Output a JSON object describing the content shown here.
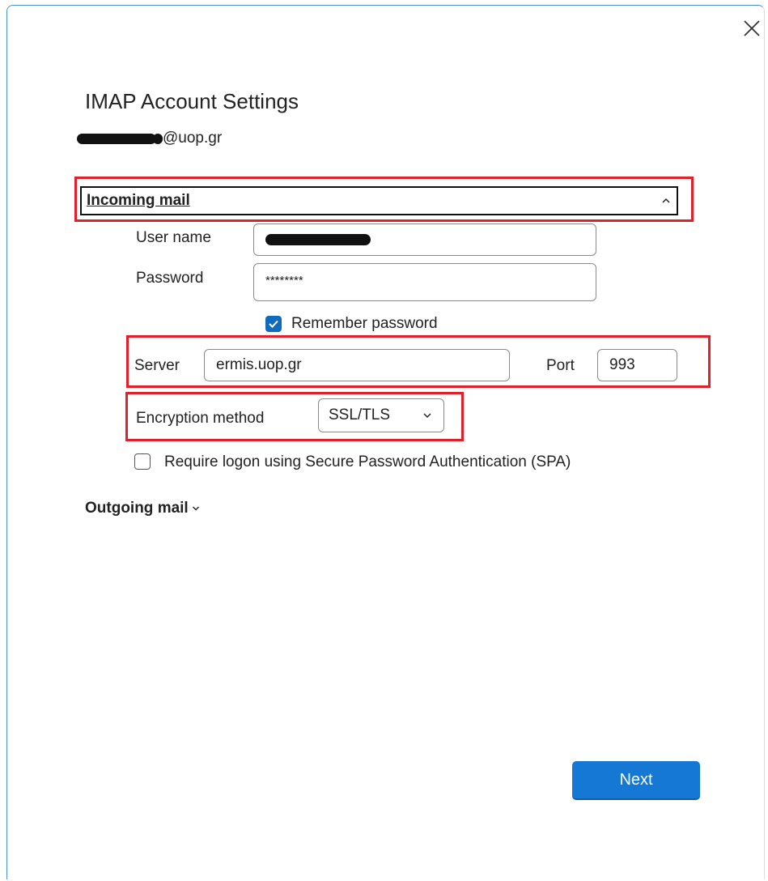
{
  "dialog": {
    "title": "IMAP Account Settings",
    "email_suffix": "@uop.gr",
    "close_icon": "close-icon"
  },
  "incoming": {
    "header_label": "Incoming mail",
    "header_icon": "chevron-up-icon",
    "username_label": "User name",
    "username_value": "",
    "password_label": "Password",
    "password_value": "********",
    "remember_label": "Remember password",
    "remember_checked": true,
    "server_label": "Server",
    "server_value": "ermis.uop.gr",
    "port_label": "Port",
    "port_value": "993",
    "encryption_label": "Encryption method",
    "encryption_value": "SSL/TLS",
    "spa_label": "Require logon using Secure Password Authentication (SPA)",
    "spa_checked": false
  },
  "outgoing": {
    "header_label": "Outgoing mail",
    "header_icon": "chevron-down-icon"
  },
  "actions": {
    "next_label": "Next"
  },
  "colors": {
    "accent": "#1478d4",
    "checkbox": "#0f6cbd",
    "highlight": "#e2202a"
  }
}
